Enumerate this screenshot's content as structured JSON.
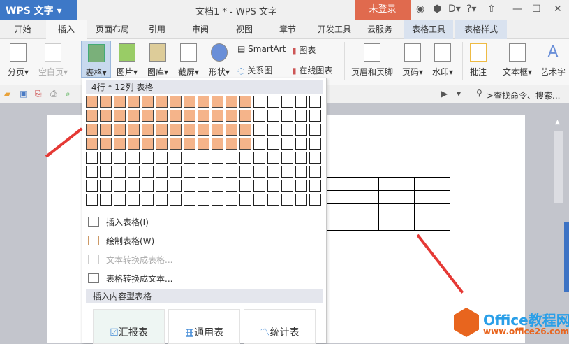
{
  "app": {
    "name": "WPS 文字",
    "title": "文档1 * - WPS 文字",
    "login": "未登录"
  },
  "tabs": [
    "开始",
    "插入",
    "页面布局",
    "引用",
    "审阅",
    "视图",
    "章节",
    "开发工具",
    "云服务",
    "表格工具",
    "表格样式"
  ],
  "ribbon": {
    "page_break": "分页",
    "blank_page": "空白页",
    "table": "表格",
    "picture": "图片",
    "gallery": "图库",
    "screenshot": "截屏",
    "shape": "形状",
    "smartart": "SmartArt",
    "chart": "图表",
    "relation": "关系图",
    "online_chart": "在线图表",
    "header_footer": "页眉和页脚",
    "page_num": "页码",
    "watermark": "水印",
    "comment": "批注",
    "textbox": "文本框",
    "wordart": "艺术字"
  },
  "search": {
    "placeholder": ">查找命令、搜索..."
  },
  "dropdown": {
    "header": "4行 * 12列 表格",
    "grid_rows": 8,
    "grid_cols": 17,
    "selected_rows": 4,
    "selected_cols": 12,
    "items": [
      {
        "label": "插入表格(I)",
        "enabled": true
      },
      {
        "label": "绘制表格(W)",
        "enabled": true
      },
      {
        "label": "文本转换成表格...",
        "enabled": false
      },
      {
        "label": "表格转换成文本...",
        "enabled": true
      }
    ],
    "section": "插入内容型表格",
    "cards": [
      "汇报表",
      "通用表",
      "统计表"
    ]
  },
  "watermark": {
    "brand": "Office教程网",
    "url": "www.office26.com"
  },
  "colors": {
    "accent": "#3d78c7",
    "login": "#e06a4e",
    "selected_cell": "#f5b48a"
  }
}
